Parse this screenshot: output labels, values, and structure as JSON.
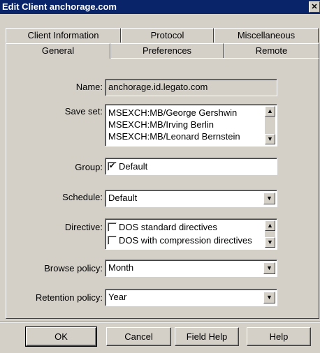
{
  "window": {
    "title": "Edit Client anchorage.com",
    "close_glyph": "✕"
  },
  "tabs": {
    "back": [
      "Client Information",
      "Protocol",
      "Miscellaneous"
    ],
    "front": [
      "General",
      "Preferences",
      "Remote"
    ],
    "active": "General"
  },
  "form": {
    "name_label": "Name:",
    "name_value": "anchorage.id.legato.com",
    "saveset_label": "Save set:",
    "saveset_items": [
      "MSEXCH:MB/George Gershwin",
      "MSEXCH:MB/Irving Berlin",
      "MSEXCH:MB/Leonard Bernstein"
    ],
    "group_label": "Group:",
    "group_item": "Default",
    "group_checked": true,
    "schedule_label": "Schedule:",
    "schedule_value": "Default",
    "directive_label": "Directive:",
    "directive_items": [
      "DOS standard directives",
      "DOS with compression directives"
    ],
    "browse_label": "Browse policy:",
    "browse_value": "Month",
    "retention_label": "Retention policy:",
    "retention_value": "Year"
  },
  "buttons": {
    "ok": "OK",
    "cancel": "Cancel",
    "field_help": "Field Help",
    "help": "Help"
  },
  "icons": {
    "scroll_up": "▲",
    "scroll_down": "▼",
    "dropdown": "▼",
    "check": "✔"
  }
}
